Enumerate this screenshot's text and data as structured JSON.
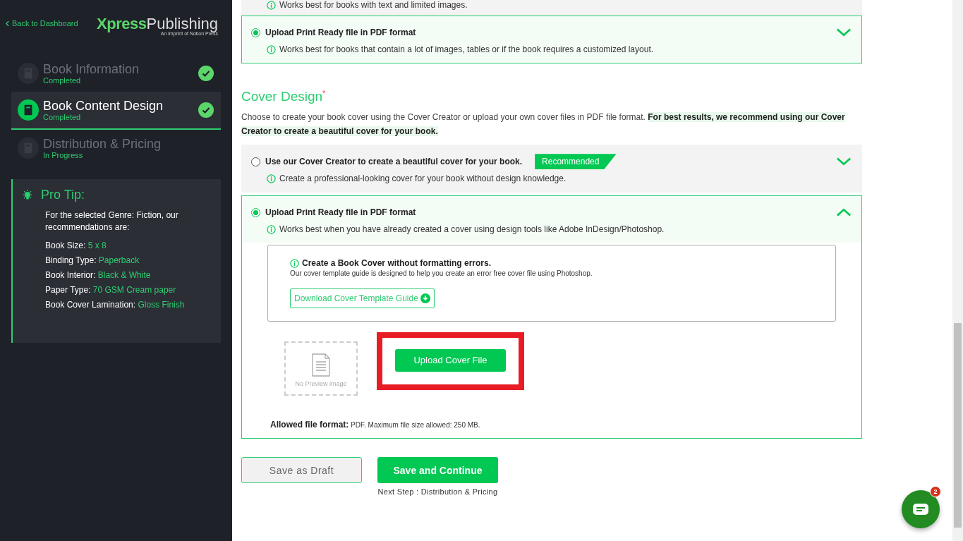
{
  "sidebar": {
    "back_link": "Back to Dashboard",
    "logo": {
      "brand_bold": "Xpress",
      "brand_light": "Publishing",
      "tagline": "An imprint of Notion Press"
    },
    "steps": [
      {
        "title": "Book Information",
        "status": "Completed",
        "completed": true,
        "selected": false
      },
      {
        "title": "Book Content Design",
        "status": "Completed",
        "completed": true,
        "selected": true
      },
      {
        "title": "Distribution & Pricing",
        "status": "In Progress",
        "completed": false,
        "selected": false
      }
    ],
    "pro_tip": {
      "title": "Pro Tip:",
      "intro": "For the selected Genre: Fiction, our recommendations are:",
      "items": [
        {
          "label": "Book Size:",
          "value": "5 x 8"
        },
        {
          "label": "Binding Type:",
          "value": "Paperback"
        },
        {
          "label": "Book Interior:",
          "value": "Black & White"
        },
        {
          "label": "Paper Type:",
          "value": "70 GSM Cream paper"
        },
        {
          "label": "Book Cover Lamination:",
          "value": "Gloss Finish"
        }
      ]
    }
  },
  "content_options": {
    "cut_note": "Works best for books with text and limited images.",
    "options": [
      {
        "title": "Upload Print Ready file in PDF format",
        "note": "Works best for books that contain a lot of images, tables or if the book requires a customized layout.",
        "selected": true,
        "expanded": false
      }
    ]
  },
  "cover_design": {
    "title": "Cover Design",
    "required_mark": "*",
    "description": "Choose to create your book cover using the Cover Creator or upload your own cover files in PDF file format. **For best results, we recommend using our Cover Creator to create a beautiful cover for your book.**",
    "options": [
      {
        "title": "Use our Cover Creator to create a beautiful cover for your book.",
        "badge": "Recommended",
        "note": "Create a professional-looking cover for your book without design knowledge.",
        "selected": false,
        "expanded": false
      },
      {
        "title": "Upload Print Ready file in PDF format",
        "note": "Works best when you have already created a cover using design tools like Adobe InDesign/Photoshop.",
        "selected": true,
        "expanded": true
      }
    ],
    "guide": {
      "title": "Create a Book Cover without formatting errors.",
      "text": "Our cover template guide is designed to help you create an error free cover file using Photoshop.",
      "button": "Download Cover Template Guide"
    },
    "preview_placeholder": "No Preview image",
    "upload_button": "Upload Cover File",
    "allowed": "**Allowed file format:** PDF. Maximum file size allowed: 250 MB."
  },
  "actions": {
    "draft": "Save as Draft",
    "continue": "Save and Continue",
    "next_step": "Next Step : Distribution & Pricing"
  },
  "chat": {
    "badge": "2"
  }
}
